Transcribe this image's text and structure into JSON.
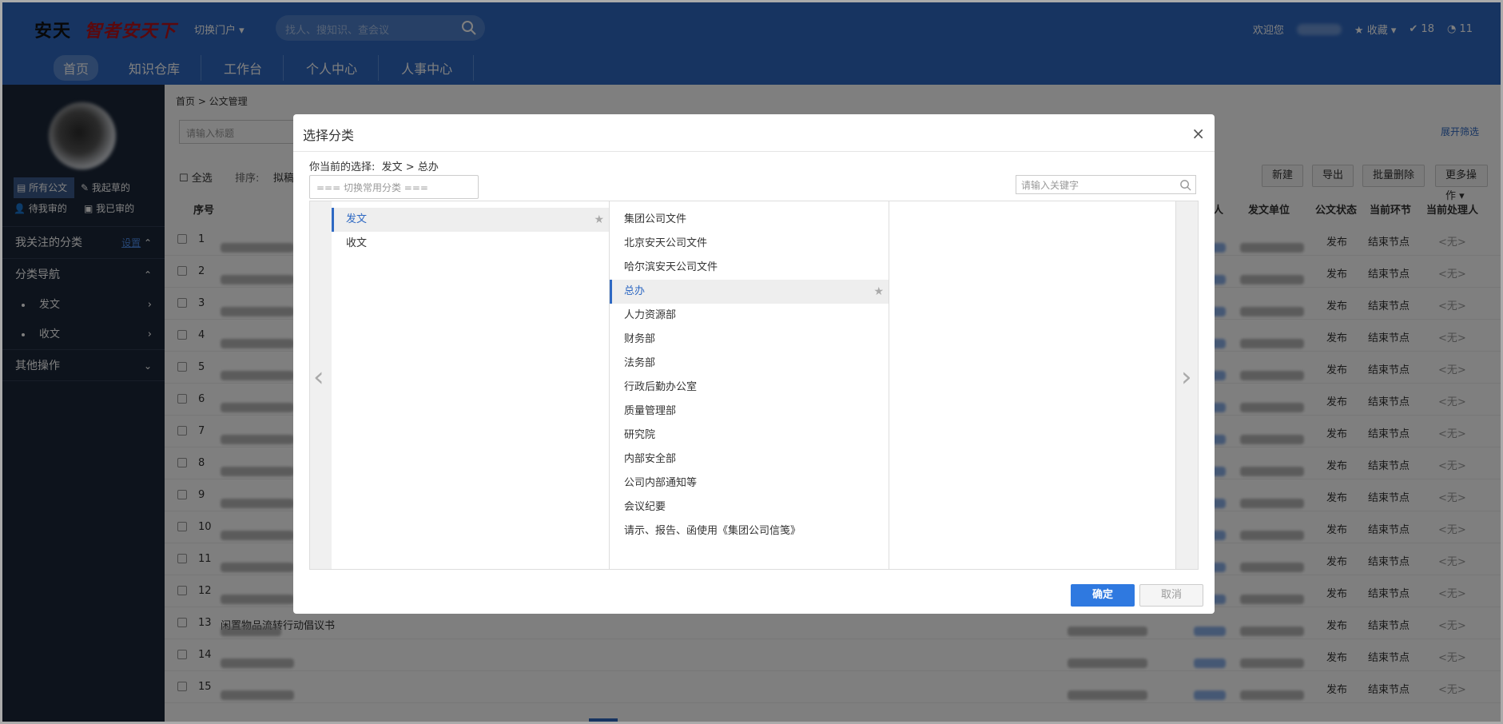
{
  "header": {
    "logo_brand": "安天",
    "logo_slogan": "智者安天下",
    "switch_portal": "切换门户 ▾",
    "search_placeholder": "找人、搜知识、查会议",
    "welcome": "欢迎您",
    "favorites": "★ 收藏 ▾",
    "count_a": "18",
    "count_b": "11",
    "nav": [
      "首页",
      "知识仓库",
      "工作台",
      "个人中心",
      "人事中心"
    ]
  },
  "sidebar": {
    "tabs": [
      "所有公文",
      "我起草的",
      "待我审的",
      "我已审的"
    ],
    "followed": "我关注的分类",
    "settings": "设置",
    "nav_title": "分类导航",
    "items": [
      "发文",
      "收文"
    ],
    "other": "其他操作"
  },
  "content": {
    "breadcrumb": "首页  >  公文管理",
    "title_placeholder": "请输入标题",
    "expand": "展开筛选",
    "select_all": "全选",
    "sort_label": "排序:",
    "sort_value": "拟稿",
    "buttons": [
      "新建",
      "导出",
      "批量删除",
      "更多操作 ▾"
    ],
    "columns": [
      "序号",
      "人",
      "发文单位",
      "公文状态",
      "当前环节",
      "当前处理人"
    ],
    "rows": [
      {
        "no": "1",
        "status": "发布",
        "step": "结束节点",
        "handler": "<无>"
      },
      {
        "no": "2",
        "status": "发布",
        "step": "结束节点",
        "handler": "<无>"
      },
      {
        "no": "3",
        "status": "发布",
        "step": "结束节点",
        "handler": "<无>"
      },
      {
        "no": "4",
        "status": "发布",
        "step": "结束节点",
        "handler": "<无>"
      },
      {
        "no": "5",
        "status": "发布",
        "step": "结束节点",
        "handler": "<无>"
      },
      {
        "no": "6",
        "status": "发布",
        "step": "结束节点",
        "handler": "<无>"
      },
      {
        "no": "7",
        "status": "发布",
        "step": "结束节点",
        "handler": "<无>"
      },
      {
        "no": "8",
        "status": "发布",
        "step": "结束节点",
        "handler": "<无>"
      },
      {
        "no": "9",
        "status": "发布",
        "step": "结束节点",
        "handler": "<无>"
      },
      {
        "no": "10",
        "status": "发布",
        "step": "结束节点",
        "handler": "<无>"
      },
      {
        "no": "11",
        "status": "发布",
        "step": "结束节点",
        "handler": "<无>"
      },
      {
        "no": "12",
        "status": "发布",
        "step": "结束节点",
        "handler": "<无>"
      },
      {
        "no": "13",
        "status": "发布",
        "step": "结束节点",
        "handler": "<无>",
        "title_tail": "闲置物品流转行动倡议书"
      },
      {
        "no": "14",
        "status": "发布",
        "step": "结束节点",
        "handler": "<无>"
      },
      {
        "no": "15",
        "status": "发布",
        "step": "结束节点",
        "handler": "<无>"
      }
    ]
  },
  "modal": {
    "title": "选择分类",
    "close": "×",
    "current_label": "你当前的选择:",
    "current_value": "发文 > 总办",
    "switch_placeholder": "=== 切换常用分类 ===",
    "keyword_placeholder": "请输入关键字",
    "col1": [
      "发文",
      "收文"
    ],
    "col2": [
      "集团公司文件",
      "北京安天公司文件",
      "哈尔滨安天公司文件",
      "总办",
      "人力资源部",
      "财务部",
      "法务部",
      "行政后勤办公室",
      "质量管理部",
      "研究院",
      "内部安全部",
      "公司内部通知等",
      "会议纪要",
      "请示、报告、函使用《集团公司信笺》"
    ],
    "prev": "‹",
    "next": "›",
    "ok": "确定",
    "cancel": "取消"
  },
  "colors": {
    "brand": "#2f69c3",
    "primary_button": "#2f79e0",
    "sidebar": "#1a2638"
  }
}
